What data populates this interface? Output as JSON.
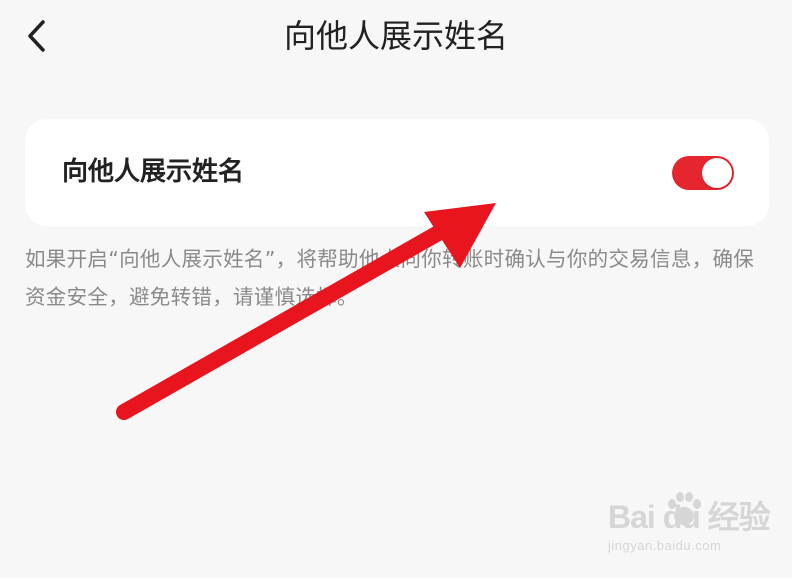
{
  "header": {
    "title": "向他人展示姓名",
    "back_icon": "chevron-left-icon"
  },
  "setting": {
    "label": "向他人展示姓名",
    "toggle_on": true,
    "toggle_color": "#e6262e"
  },
  "description": "如果开启“向他人展示姓名”，将帮助他人向你转账时确认与你的交易信息，确保资金安全，避免转错，请谨慎选择。",
  "annotation": {
    "arrow_color": "#e8141e"
  },
  "watermark": {
    "logo": "Bai du 经验",
    "url": "jingyan.baidu.com"
  }
}
